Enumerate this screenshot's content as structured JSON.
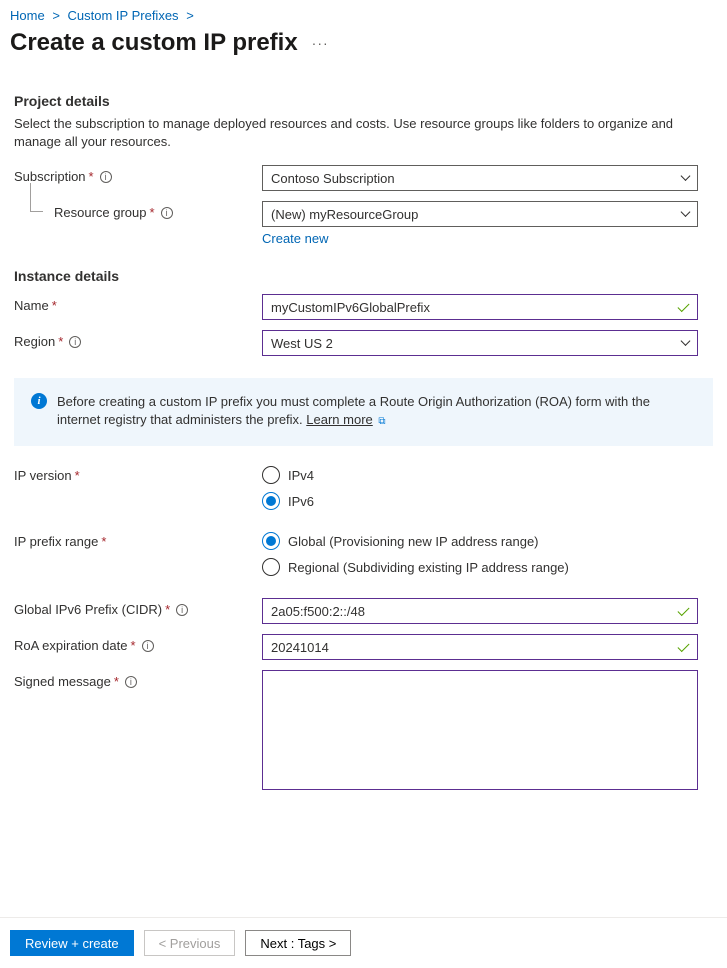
{
  "breadcrumb": {
    "home": "Home",
    "path1": "Custom IP Prefixes"
  },
  "page": {
    "title": "Create a custom IP prefix"
  },
  "project": {
    "header": "Project details",
    "desc": "Select the subscription to manage deployed resources and costs. Use resource groups like folders to organize and manage all your resources.",
    "subscription_label": "Subscription",
    "subscription_value": "Contoso Subscription",
    "resource_group_label": "Resource group",
    "resource_group_value": "(New) myResourceGroup",
    "create_new": "Create new"
  },
  "instance": {
    "header": "Instance details",
    "name_label": "Name",
    "name_value": "myCustomIPv6GlobalPrefix",
    "region_label": "Region",
    "region_value": "West US 2"
  },
  "callout": {
    "text": "Before creating a custom IP prefix you must complete a Route Origin Authorization (ROA) form with the internet registry that administers the prefix. ",
    "learn_more": "Learn more"
  },
  "ip": {
    "version_label": "IP version",
    "ipv4": "IPv4",
    "ipv6": "IPv6",
    "range_label": "IP prefix range",
    "global": "Global (Provisioning new IP address range)",
    "regional": "Regional (Subdividing existing IP address range)",
    "cidr_label": "Global IPv6 Prefix (CIDR)",
    "cidr_value": "2a05:f500:2::/48",
    "roa_label": "RoA expiration date",
    "roa_value": "20241014",
    "signed_label": "Signed message"
  },
  "footer": {
    "review": "Review + create",
    "previous": "< Previous",
    "next": "Next : Tags >"
  }
}
